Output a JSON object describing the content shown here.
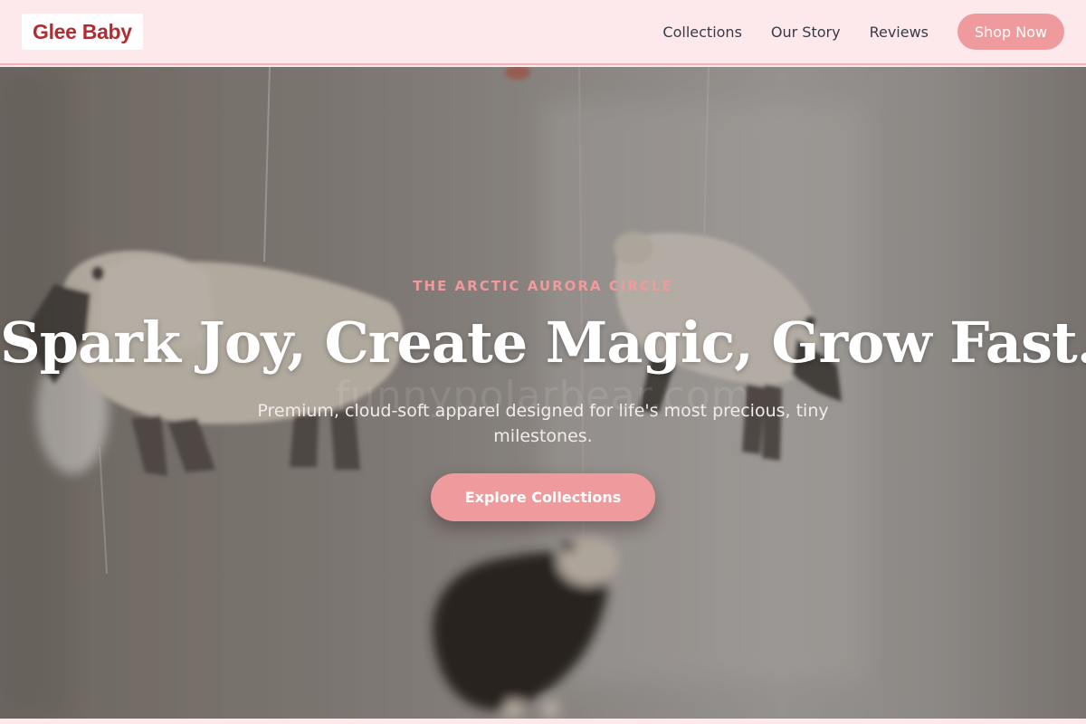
{
  "brand": {
    "name": "Glee Baby"
  },
  "nav": {
    "links": [
      "Collections",
      "Our Story",
      "Reviews"
    ],
    "cta_label": "Shop Now"
  },
  "hero": {
    "eyebrow": "THE ARCTIC AURORA CIRCLE",
    "headline": "Spark Joy, Create Magic, Grow Fast.",
    "subtitle": "Premium, cloud-soft apparel designed for life's most precious, tiny milestones.",
    "cta_label": "Explore Collections",
    "watermark": "funnypolarbear.com",
    "image_subject": "knitted-sheep-mobile-photo"
  },
  "colors": {
    "header_bg": "#fde8ec",
    "brand_text": "#b22d33",
    "accent": "#ef9a9c",
    "nav_text": "#3a3a46"
  }
}
